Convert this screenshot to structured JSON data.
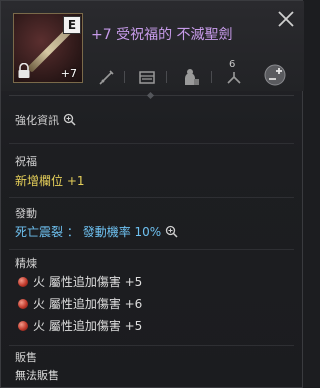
{
  "item": {
    "name": "+7 受祝福的 不滅聖劍",
    "grade": "E",
    "enhance": "+7",
    "icon": "holy-sword-icon"
  },
  "header_icons": {
    "level": "6",
    "icons": [
      "sword-type-icon",
      "chest-icon",
      "class-restriction-icon",
      "level-requirement-icon",
      "add-icon"
    ]
  },
  "sections": {
    "enhance_info": {
      "title": "強化資訊"
    },
    "blessing": {
      "title": "祝福",
      "value": "新增欄位 +1"
    },
    "activation": {
      "title": "發動",
      "skill": "死亡震裂",
      "rate_label": "發動機率",
      "rate": "10%"
    },
    "refine": {
      "title": "精煉",
      "lines": [
        {
          "text": "火 屬性追加傷害 +5"
        },
        {
          "text": "火 屬性追加傷害 +6"
        },
        {
          "text": "火 屬性追加傷害 +5"
        }
      ]
    },
    "trade": {
      "title": "販售",
      "value": "無法販售"
    }
  }
}
